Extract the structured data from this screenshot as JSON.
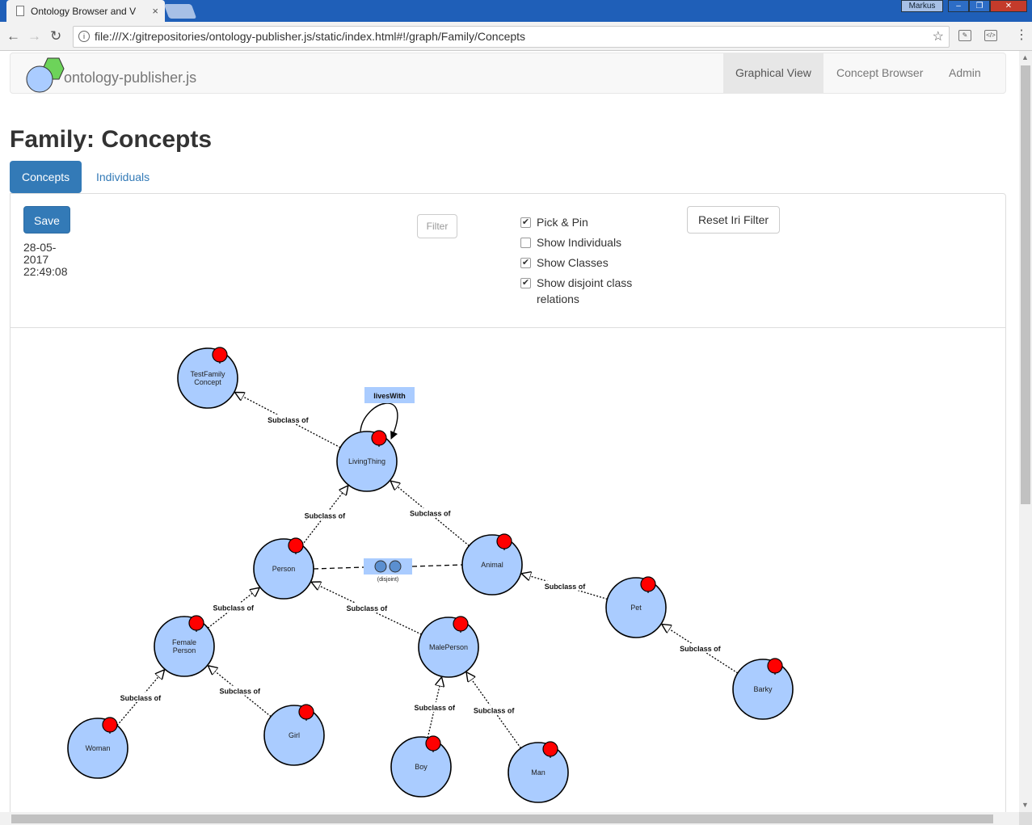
{
  "browser": {
    "tab_title": "Ontology Browser and V",
    "tab_close": "×",
    "url": "file:///X:/gitrepositories/ontology-publisher.js/static/index.html#!/graph/Family/Concepts",
    "user": "Markus",
    "win_min": "–",
    "win_max": "❐",
    "win_close": "✕",
    "back": "←",
    "forward": "→",
    "reload": "↻",
    "info": "i",
    "star": "☆",
    "menu": "⋮",
    "ext1": "✎",
    "ext2": "</>"
  },
  "navbar": {
    "brand": "ontology-publisher.js",
    "items": [
      {
        "label": "Graphical View",
        "active": true
      },
      {
        "label": "Concept Browser",
        "active": false
      },
      {
        "label": "Admin",
        "active": false
      }
    ]
  },
  "page": {
    "title": "Family: Concepts",
    "pills": [
      {
        "label": "Concepts",
        "active": true
      },
      {
        "label": "Individuals",
        "active": false
      }
    ]
  },
  "controls": {
    "save_label": "Save",
    "save_time": "28-05-2017 22:49:08",
    "filter_placeholder": "Filter",
    "options": [
      {
        "label": "Pick & Pin",
        "checked": true
      },
      {
        "label": "Show Individuals",
        "checked": false
      },
      {
        "label": "Show Classes",
        "checked": true
      },
      {
        "label": "Show disjoint class relations",
        "checked": true
      }
    ],
    "reset_label": "Reset Iri Filter",
    "check_mark": "✔"
  },
  "graph": {
    "nodes": [
      {
        "id": "testfamily",
        "lines": [
          "TestFamily",
          "Concept"
        ]
      },
      {
        "id": "livingthing",
        "lines": [
          "LivingThing"
        ]
      },
      {
        "id": "person",
        "lines": [
          "Person"
        ]
      },
      {
        "id": "animal",
        "lines": [
          "Animal"
        ]
      },
      {
        "id": "femaleperson",
        "lines": [
          "Female",
          "Person"
        ]
      },
      {
        "id": "maleperson",
        "lines": [
          "MalePerson"
        ]
      },
      {
        "id": "pet",
        "lines": [
          "Pet"
        ]
      },
      {
        "id": "woman",
        "lines": [
          "Woman"
        ]
      },
      {
        "id": "girl",
        "lines": [
          "Girl"
        ]
      },
      {
        "id": "boy",
        "lines": [
          "Boy"
        ]
      },
      {
        "id": "man",
        "lines": [
          "Man"
        ]
      },
      {
        "id": "barky",
        "lines": [
          "Barky"
        ]
      }
    ],
    "edges": [
      {
        "from": "livingthing",
        "to": "testfamily",
        "label": "Subclass of"
      },
      {
        "from": "person",
        "to": "livingthing",
        "label": "Subclass of"
      },
      {
        "from": "animal",
        "to": "livingthing",
        "label": "Subclass of"
      },
      {
        "from": "femaleperson",
        "to": "person",
        "label": "Subclass of"
      },
      {
        "from": "maleperson",
        "to": "person",
        "label": "Subclass of"
      },
      {
        "from": "pet",
        "to": "animal",
        "label": "Subclass of"
      },
      {
        "from": "woman",
        "to": "femaleperson",
        "label": "Subclass of"
      },
      {
        "from": "girl",
        "to": "femaleperson",
        "label": "Subclass of"
      },
      {
        "from": "boy",
        "to": "maleperson",
        "label": "Subclass of"
      },
      {
        "from": "man",
        "to": "maleperson",
        "label": "Subclass of"
      },
      {
        "from": "barky",
        "to": "pet",
        "label": "Subclass of"
      }
    ],
    "self_relation": {
      "node": "livingthing",
      "label": "livesWith"
    },
    "disjoint": {
      "a": "person",
      "b": "animal",
      "label": "(disjoint)"
    }
  },
  "colors": {
    "accent": "#337ab7",
    "node_fill": "#aaccff",
    "pin": "#ff0000",
    "relation_box": "#aaccff"
  }
}
